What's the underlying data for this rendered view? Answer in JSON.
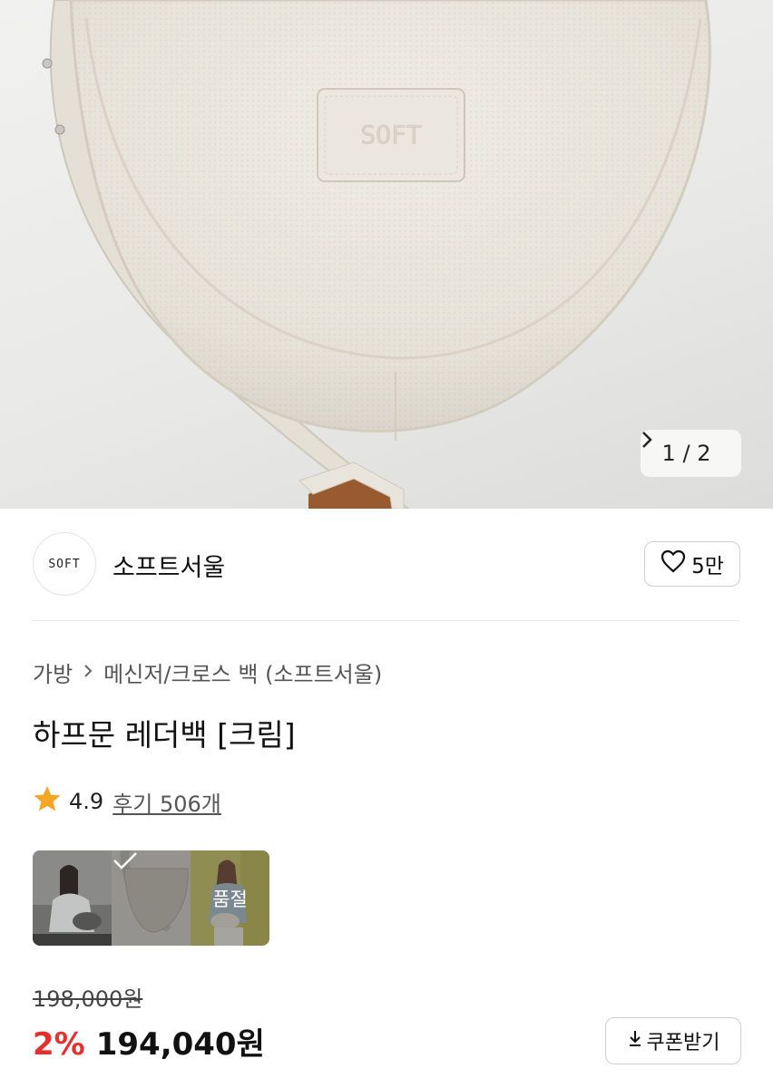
{
  "gallery": {
    "current": "1",
    "separator": "/",
    "total": "2",
    "next_icon": "chevron-right-icon"
  },
  "brand": {
    "logo_text": "SOFT",
    "name": "소프트서울",
    "like_count": "5만"
  },
  "breadcrumb": {
    "category": "가방",
    "subcategory": "메신저/크로스 백 (소프트서울)"
  },
  "product": {
    "title": "하프문 레더백 [크림]"
  },
  "rating": {
    "score": "4.9",
    "reviews_label": "후기 506개",
    "star_color": "#f5a623"
  },
  "options": [
    {
      "name": "model-photo-gray"
    },
    {
      "name": "cream-bag",
      "selected": true
    },
    {
      "name": "model-photo-olive",
      "status": "품절"
    }
  ],
  "price": {
    "original": "198,000원",
    "discount": "2%",
    "sale": "194,040원",
    "discount_color": "#e5312d"
  },
  "coupon": {
    "label": "쿠폰받기"
  }
}
